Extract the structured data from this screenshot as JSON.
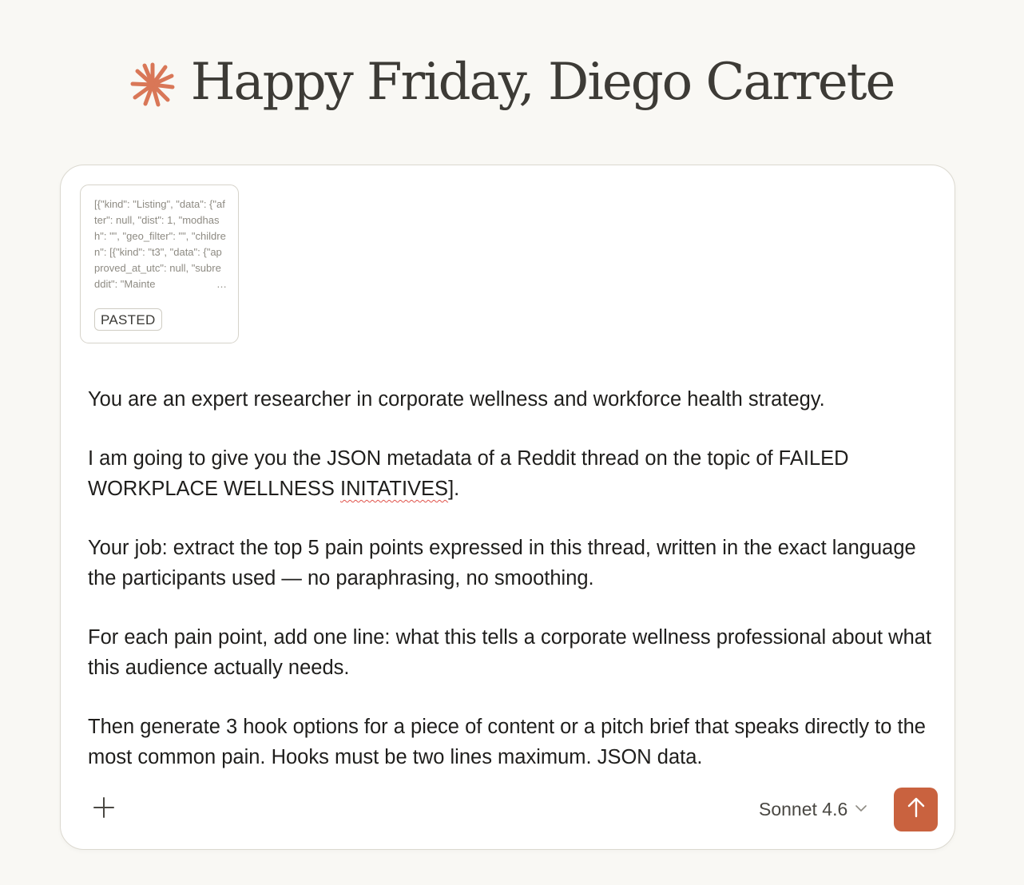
{
  "greeting": {
    "title": "Happy Friday, Diego Carrete",
    "icon": "claude-spark-icon",
    "icon_color": "#d97757"
  },
  "attachment": {
    "preview_text": "[{\"kind\": \"Listing\", \"data\": {\"after\": null, \"dist\": 1, \"modhash\": \"\", \"geo_filter\": \"\", \"children\": [{\"kind\": \"t3\", \"data\": {\"approved_at_utc\": null, \"subreddit\": \"Mainte",
    "ellipsis": "…",
    "badge": "PASTED"
  },
  "prompt": {
    "p1": "You are an expert researcher in corporate wellness and workforce health strategy.",
    "p2_a": "I am going to give you the JSON metadata of a Reddit thread on the topic of FAILED WORKPLACE WELLNESS ",
    "p2_misspelled": "INITATIVES",
    "p2_b": "].",
    "p3": "Your job: extract the top 5 pain points expressed in this thread, written in the exact language the participants used — no paraphrasing, no smoothing.",
    "p4": "For each pain point, add one line: what this tells a corporate wellness professional about what this audience actually needs.",
    "p5": "Then generate 3 hook options for a piece of content or a pitch brief that speaks directly to the most common pain. Hooks must be two lines maximum. JSON data."
  },
  "toolbar": {
    "add_icon": "plus-icon",
    "model_label": "Sonnet 4.6",
    "model_chevron": "chevron-down-icon",
    "send_icon": "arrow-up-icon",
    "send_color": "#c9623f"
  }
}
